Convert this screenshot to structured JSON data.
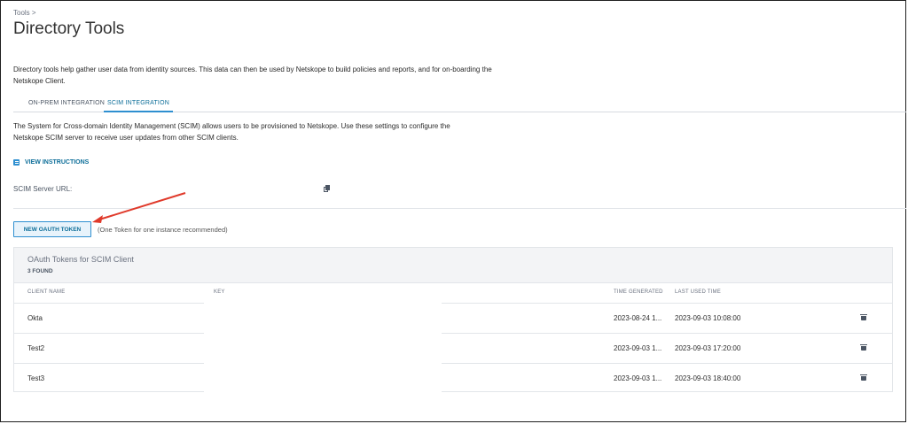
{
  "breadcrumb": "Tools >",
  "title": "Directory Tools",
  "description": "Directory tools help gather user data from identity sources. This data can then be used by Netskope to build policies and reports, and for on-boarding the Netskope Client.",
  "tabs": [
    {
      "label": "ON-PREM INTEGRATION",
      "active": false
    },
    {
      "label": "SCIM INTEGRATION",
      "active": true
    }
  ],
  "scim_description": "The System for Cross-domain Identity Management (SCIM) allows users to be provisioned to Netskope. Use these settings to configure the Netskope SCIM server to receive user updates from other SCIM clients.",
  "view_instructions": "VIEW INSTRUCTIONS",
  "scim_server_url_label": "SCIM Server URL:",
  "new_token_button": "NEW OAUTH TOKEN",
  "token_note": "(One Token for one instance recommended)",
  "table": {
    "title": "OAuth Tokens for SCIM Client",
    "count": "3 FOUND",
    "columns": [
      "CLIENT NAME",
      "KEY",
      "TIME GENERATED",
      "LAST USED TIME"
    ],
    "rows": [
      {
        "client": "Okta",
        "generated": "2023-08-24 1...",
        "last_used": "2023-09-03 10:08:00"
      },
      {
        "client": "Test2",
        "generated": "2023-09-03 1...",
        "last_used": "2023-09-03 17:20:00"
      },
      {
        "client": "Test3",
        "generated": "2023-09-03 1...",
        "last_used": "2023-09-03 18:40:00"
      }
    ]
  },
  "colors": {
    "accent": "#2e8fd0",
    "arrow": "#e03a2b"
  },
  "icons": [
    "doc-icon",
    "copy-icon",
    "trash-icon"
  ]
}
